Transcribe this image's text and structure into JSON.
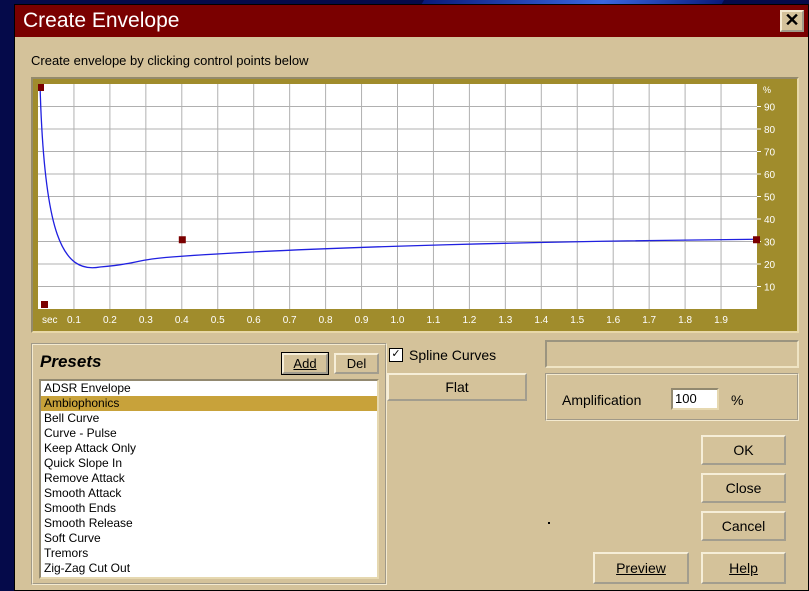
{
  "window": {
    "title": "Create Envelope",
    "close_glyph": "✕"
  },
  "instruction": "Create envelope by clicking control points below",
  "graph": {
    "x_unit": "sec",
    "x_ticks": [
      "0.1",
      "0.2",
      "0.3",
      "0.4",
      "0.5",
      "0.6",
      "0.7",
      "0.8",
      "0.9",
      "1.0",
      "1.1",
      "1.2",
      "1.3",
      "1.4",
      "1.5",
      "1.6",
      "1.7",
      "1.8",
      "1.9"
    ],
    "y_unit": "%",
    "y_ticks": [
      "90",
      "80",
      "70",
      "60",
      "50",
      "40",
      "30",
      "20",
      "10"
    ],
    "control_points": [
      {
        "t": 0.0,
        "pct": 100
      },
      {
        "t": 0.0,
        "pct": 0
      },
      {
        "t": 0.4,
        "pct": 31
      },
      {
        "t": 2.0,
        "pct": 31
      }
    ],
    "line_color": "#2020e0",
    "point_color": "#7a0000",
    "bg_color": "#ffffff",
    "grid_color": "#b0b0b0"
  },
  "presets": {
    "title": "Presets",
    "add_label": "Add",
    "del_label": "Del",
    "items": [
      "ADSR Envelope",
      "Ambiophonics",
      "Bell Curve",
      "Curve - Pulse",
      "Keep Attack Only",
      "Quick Slope In",
      "Remove Attack",
      "Smooth Attack",
      "Smooth Ends",
      "Smooth Release",
      "Soft Curve",
      "Tremors",
      "Zig-Zag Cut Out"
    ],
    "selected": "Ambiophonics"
  },
  "spline": {
    "label": "Spline Curves",
    "checked": true,
    "mark": "✓"
  },
  "flat_label": "Flat",
  "amplification": {
    "label": "Amplification",
    "value": "100",
    "unit": "%"
  },
  "buttons": {
    "ok": "OK",
    "close": "Close",
    "cancel": "Cancel",
    "preview": "Preview",
    "help": "Help"
  }
}
